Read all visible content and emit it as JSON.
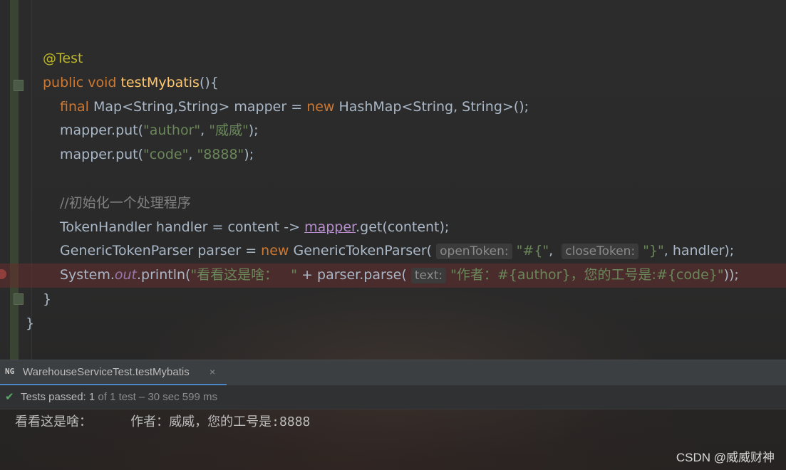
{
  "editor": {
    "lines": [
      {
        "indent": 60,
        "tokens": [
          {
            "c": "ann",
            "t": "@Test"
          }
        ]
      },
      {
        "indent": 60,
        "tokens": [
          {
            "c": "kw",
            "t": "public void "
          },
          {
            "c": "fn",
            "t": "testMybatis"
          },
          {
            "c": "",
            "t": "(){"
          }
        ]
      },
      {
        "indent": 84,
        "tokens": [
          {
            "c": "kw",
            "t": "final "
          },
          {
            "c": "",
            "t": "Map<String,String> mapper = "
          },
          {
            "c": "kw",
            "t": "new "
          },
          {
            "c": "",
            "t": "HashMap<String, String>();"
          }
        ]
      },
      {
        "indent": 84,
        "tokens": [
          {
            "c": "",
            "t": "mapper.put("
          },
          {
            "c": "str",
            "t": "\"author\""
          },
          {
            "c": "",
            "t": ", "
          },
          {
            "c": "str",
            "t": "\"威威\""
          },
          {
            "c": "",
            "t": ");"
          }
        ]
      },
      {
        "indent": 84,
        "tokens": [
          {
            "c": "",
            "t": "mapper.put("
          },
          {
            "c": "str",
            "t": "\"code\""
          },
          {
            "c": "",
            "t": ", "
          },
          {
            "c": "str",
            "t": "\"8888\""
          },
          {
            "c": "",
            "t": ");"
          }
        ]
      },
      {
        "indent": 84,
        "tokens": []
      },
      {
        "indent": 84,
        "tokens": [
          {
            "c": "cmt",
            "t": "//初始化一个处理程序"
          }
        ]
      },
      {
        "indent": 84,
        "tokens": [
          {
            "c": "",
            "t": "TokenHandler handler = content -> "
          },
          {
            "c": "ulink",
            "t": "mapper"
          },
          {
            "c": "",
            "t": ".get(content);"
          }
        ]
      },
      {
        "indent": 84,
        "tokens": [
          {
            "c": "",
            "t": "GenericTokenParser parser = "
          },
          {
            "c": "kw",
            "t": "new "
          },
          {
            "c": "",
            "t": "GenericTokenParser( "
          },
          {
            "c": "hint",
            "t": "openToken:"
          },
          {
            "c": "str",
            "t": "\"#{\""
          },
          {
            "c": "",
            "t": ",  "
          },
          {
            "c": "hint",
            "t": "closeToken:"
          },
          {
            "c": "str",
            "t": "\"}\""
          },
          {
            "c": "",
            "t": ", handler);"
          }
        ]
      },
      {
        "indent": 84,
        "highlight": true,
        "tokens": [
          {
            "c": "",
            "t": "System."
          },
          {
            "c": "fld",
            "t": "out"
          },
          {
            "c": "",
            "t": ".println("
          },
          {
            "c": "str",
            "t": "\"看看这是啥：   \""
          },
          {
            "c": "",
            "t": " + parser.parse( "
          },
          {
            "c": "hint",
            "t": "text:"
          },
          {
            "c": "str",
            "t": "\"作者：#{author}，您的工号是:#{code}\""
          },
          {
            "c": "",
            "t": "));"
          }
        ]
      },
      {
        "indent": 60,
        "tokens": [
          {
            "c": "",
            "t": "}"
          }
        ]
      },
      {
        "indent": 36,
        "tokens": [
          {
            "c": "",
            "t": "}"
          }
        ]
      }
    ]
  },
  "run_panel": {
    "tab_icon": "NG",
    "tab_title": "WarehouseServiceTest.testMybatis",
    "tab_close": "×",
    "status_icon": "check-icon",
    "status_label": "Tests passed: ",
    "status_count": "1",
    "status_detail": " of 1 test – 30 sec 599 ms",
    "output": "看看这是啥：     作者：威威，您的工号是:8888"
  },
  "watermark": "CSDN @威威财神",
  "colors": {
    "keyword": "#cc7832",
    "annotation": "#bbb529",
    "method": "#ffc66d",
    "string": "#6a8759",
    "comment": "#808080",
    "field": "#9876aa",
    "plain": "#a9b7c6",
    "breakpoint": "#c75450",
    "tab_underline": "#4a88c7",
    "pass_check": "#59a869"
  }
}
